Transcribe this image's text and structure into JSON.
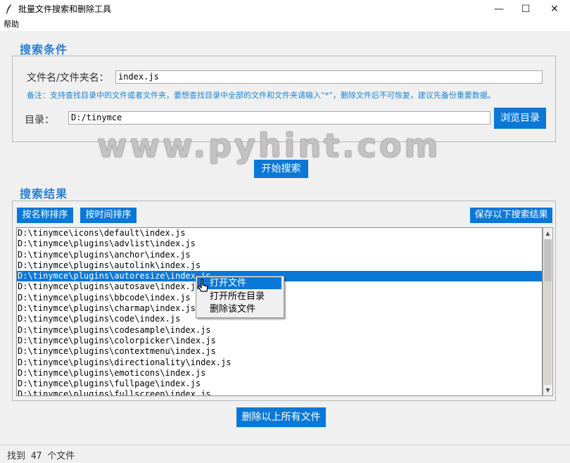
{
  "window": {
    "title": "批量文件搜索和删除工具",
    "minimize": "—",
    "maximize": "☐",
    "close": "✕"
  },
  "menu": {
    "help": "帮助"
  },
  "search_section": {
    "title": "搜索条件",
    "filename_label": "文件名/文件夹名：",
    "filename_value": "index.js",
    "note": "备注：支持查找目录中的文件或者文件夹，要想查找目录中全部的文件和文件夹请输入“*”，删除文件后不可恢复，建议先备份重要数据。",
    "dir_label": "目录：",
    "dir_value": "D:/tinymce",
    "browse_button": "浏览目录",
    "start_button": "开始搜索"
  },
  "watermark": "www.pyhint.com",
  "results_section": {
    "title": "搜索结果",
    "sort_by_name": "按名称排序",
    "sort_by_time": "按时间排序",
    "save_results": "保存以下搜索结果",
    "selected_index": 4,
    "rows": [
      "D:\\tinymce\\icons\\default\\index.js",
      "D:\\tinymce\\plugins\\advlist\\index.js",
      "D:\\tinymce\\plugins\\anchor\\index.js",
      "D:\\tinymce\\plugins\\autolink\\index.js",
      "D:\\tinymce\\plugins\\autoresize\\index.js",
      "D:\\tinymce\\plugins\\autosave\\index.js",
      "D:\\tinymce\\plugins\\bbcode\\index.js",
      "D:\\tinymce\\plugins\\charmap\\index.js",
      "D:\\tinymce\\plugins\\code\\index.js",
      "D:\\tinymce\\plugins\\codesample\\index.js",
      "D:\\tinymce\\plugins\\colorpicker\\index.js",
      "D:\\tinymce\\plugins\\contextmenu\\index.js",
      "D:\\tinymce\\plugins\\directionality\\index.js",
      "D:\\tinymce\\plugins\\emoticons\\index.js",
      "D:\\tinymce\\plugins\\fullpage\\index.js",
      "D:\\tinymce\\plugins\\fullscreen\\index.js"
    ],
    "delete_button": "删除以上所有文件"
  },
  "context_menu": {
    "items": [
      "打开文件",
      "打开所在目录",
      "删除该文件"
    ],
    "highlighted": 0
  },
  "status": "找到 47 个文件",
  "colors": {
    "accent": "#0a78d7",
    "section_title": "#2a7fd0",
    "note": "#1b84d3"
  }
}
